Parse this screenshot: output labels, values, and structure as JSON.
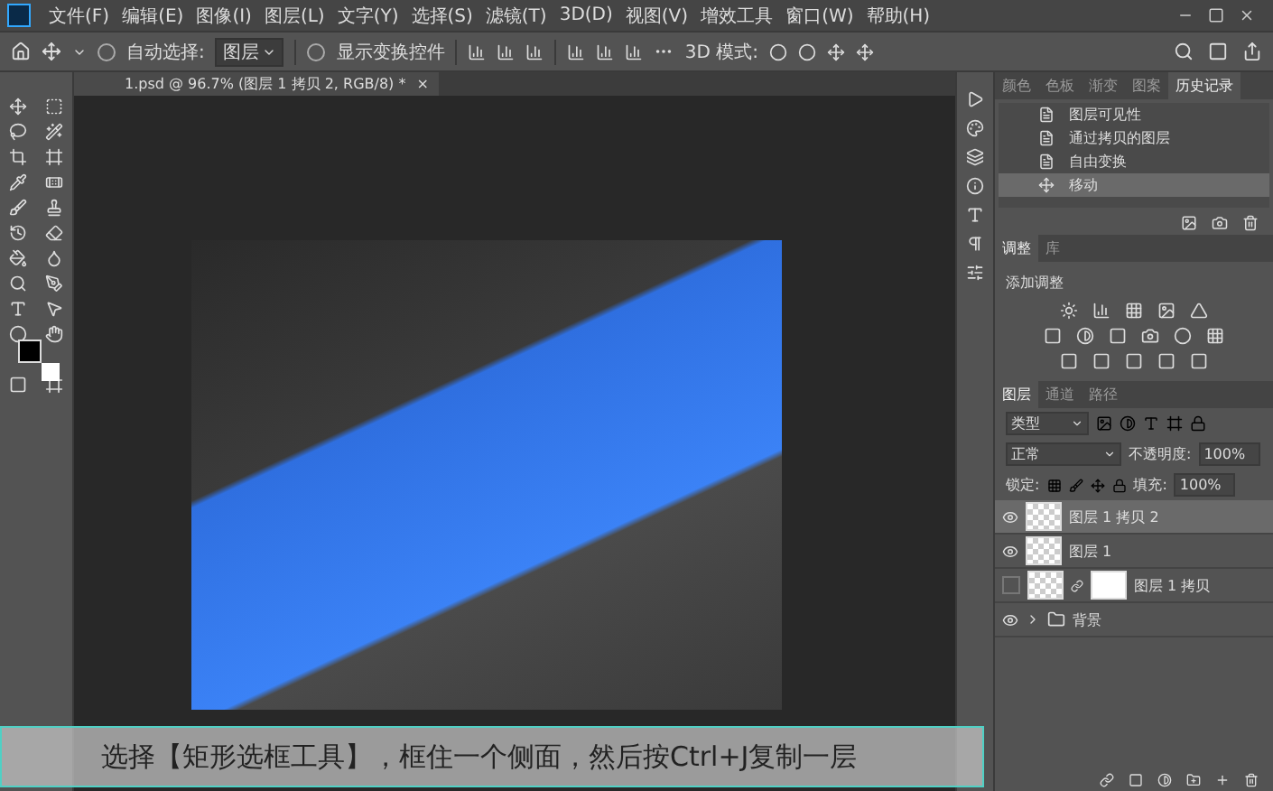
{
  "menu_bar": {
    "items": [
      "文件(F)",
      "编辑(E)",
      "图像(I)",
      "图层(L)",
      "文字(Y)",
      "选择(S)",
      "滤镜(T)",
      "3D(D)",
      "视图(V)",
      "增效工具",
      "窗口(W)",
      "帮助(H)"
    ]
  },
  "options_bar": {
    "auto_select_label": "自动选择:",
    "auto_select_checked": false,
    "target": "图层",
    "show_transform_label": "显示变换控件",
    "show_transform_checked": false,
    "mode_3d_label": "3D 模式:"
  },
  "document_tab": {
    "title": "1.psd @ 96.7% (图层 1 拷贝 2, RGB/8) *",
    "close": "×"
  },
  "history_panel": {
    "tabs": [
      {
        "label": "颜色",
        "selected": false
      },
      {
        "label": "色板",
        "selected": false
      },
      {
        "label": "渐变",
        "selected": false
      },
      {
        "label": "图案",
        "selected": false
      },
      {
        "label": "历史记录",
        "selected": true
      }
    ],
    "items": [
      {
        "label": "图层可见性",
        "kind": "doc",
        "selected": false
      },
      {
        "label": "通过拷贝的图层",
        "kind": "doc",
        "selected": false
      },
      {
        "label": "自由变换",
        "kind": "doc",
        "selected": false
      },
      {
        "label": "移动",
        "kind": "move",
        "selected": true
      }
    ]
  },
  "adjustments_panel": {
    "tabs": [
      {
        "label": "调整",
        "selected": true
      },
      {
        "label": "库",
        "selected": false
      }
    ],
    "heading": "添加调整"
  },
  "layers_panel": {
    "tabs": [
      {
        "label": "图层",
        "selected": true
      },
      {
        "label": "通道",
        "selected": false
      },
      {
        "label": "路径",
        "selected": false
      }
    ],
    "filter": "类型",
    "blend_mode": "正常",
    "opacity_label": "不透明度:",
    "opacity": "100%",
    "lock_label": "锁定:",
    "fill_label": "填充:",
    "fill": "100%",
    "layers": [
      {
        "name": "图层 1 拷贝 2",
        "kind": "layer",
        "visible": true,
        "selected": true
      },
      {
        "name": "图层 1",
        "kind": "layer",
        "visible": true,
        "selected": false
      },
      {
        "name": "图层 1 拷贝",
        "kind": "masked",
        "visible": false,
        "selected": false
      },
      {
        "name": "背景",
        "kind": "group",
        "visible": true,
        "selected": false
      }
    ]
  },
  "caption": "选择【矩形选框工具】，框住一个侧面，然后按Ctrl+J复制一层"
}
